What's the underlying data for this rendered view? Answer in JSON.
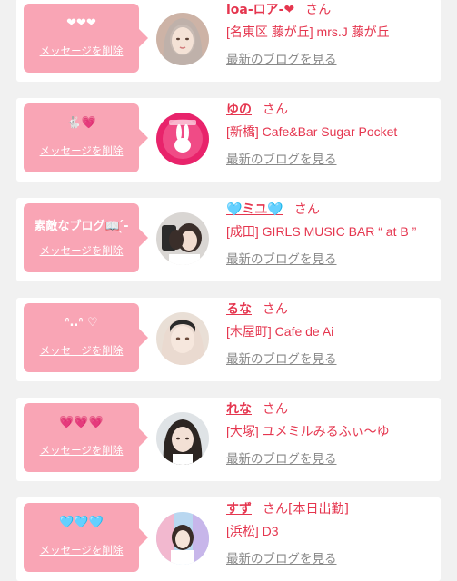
{
  "colors": {
    "accent": "#e5364f",
    "bubble": "#f9a5b5",
    "muted": "#8a8a8a",
    "background": "#f1f1f1"
  },
  "cards": [
    {
      "bubble_message": "❤❤❤",
      "delete_label": "メッセージを削除",
      "name": "loa-ロア-❤",
      "honorific": "さん",
      "status": "",
      "shop": "[名東区 藤が丘] mrs.J 藤が丘",
      "blog_link": "最新のブログを見る"
    },
    {
      "bubble_message": "🐇💗",
      "delete_label": "メッセージを削除",
      "name": "ゆの",
      "honorific": "さん",
      "status": "",
      "shop": "[新橋] Cafe&Bar Sugar Pocket",
      "blog_link": "最新のブログを見る"
    },
    {
      "bubble_message": "素敵なブログ📖 ̖́-",
      "delete_label": "メッセージを削除",
      "name": "🩵ミユ🩵",
      "honorific": "さん",
      "status": "",
      "shop": "[成田] GIRLS MUSIC BAR “ at B ”",
      "blog_link": "最新のブログを見る"
    },
    {
      "bubble_message": "ᐢ..ᐢ ♡",
      "delete_label": "メッセージを削除",
      "name": "るな",
      "honorific": "さん",
      "status": "",
      "shop": "[木屋町] Cafe de Ai",
      "blog_link": "最新のブログを見る"
    },
    {
      "bubble_message": "💗💗💗",
      "delete_label": "メッセージを削除",
      "name": "れな",
      "honorific": "さん",
      "status": "",
      "shop": "[大塚] ユメミルみるふぃ〜ゆ",
      "blog_link": "最新のブログを見る"
    },
    {
      "bubble_message": "🩵🩵🩵",
      "delete_label": "メッセージを削除",
      "name": "すず",
      "honorific": "さん",
      "status": "[本日出勤]",
      "shop": "[浜松] D3",
      "blog_link": "最新のブログを見る"
    }
  ]
}
